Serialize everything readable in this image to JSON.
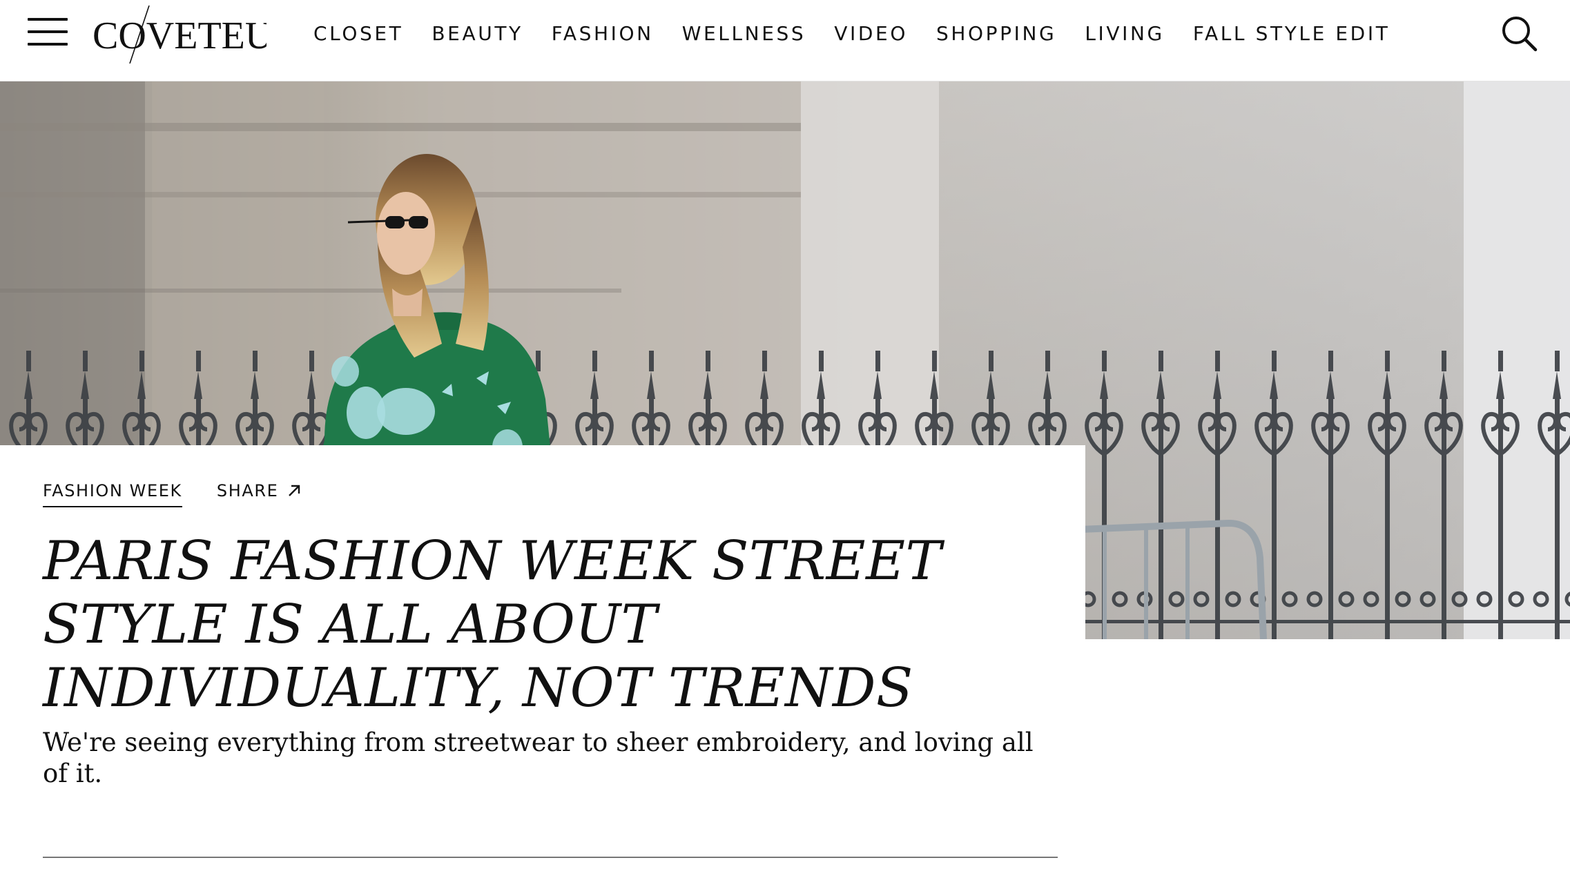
{
  "header": {
    "logo_text": "COVETEUR",
    "nav": [
      "CLOSET",
      "BEAUTY",
      "FASHION",
      "WELLNESS",
      "VIDEO",
      "SHOPPING",
      "LIVING",
      "FALL STYLE EDIT"
    ],
    "icons": {
      "menu": "hamburger-menu-icon",
      "search": "search-icon"
    }
  },
  "article": {
    "category": "FASHION WEEK",
    "share_label": "SHARE",
    "title": "PARIS FASHION WEEK STREET STYLE IS ALL ABOUT INDIVIDUALITY, NOT TRENDS",
    "dek": "We're seeing everything from streetwear to sheer embroidery, and loving all of it."
  },
  "colors": {
    "text": "#111111",
    "sweater_green": "#1f7a4a",
    "embroidery": "#a8dde0",
    "stone": "#bdb6ac",
    "iron_fence": "#3b3f44"
  }
}
